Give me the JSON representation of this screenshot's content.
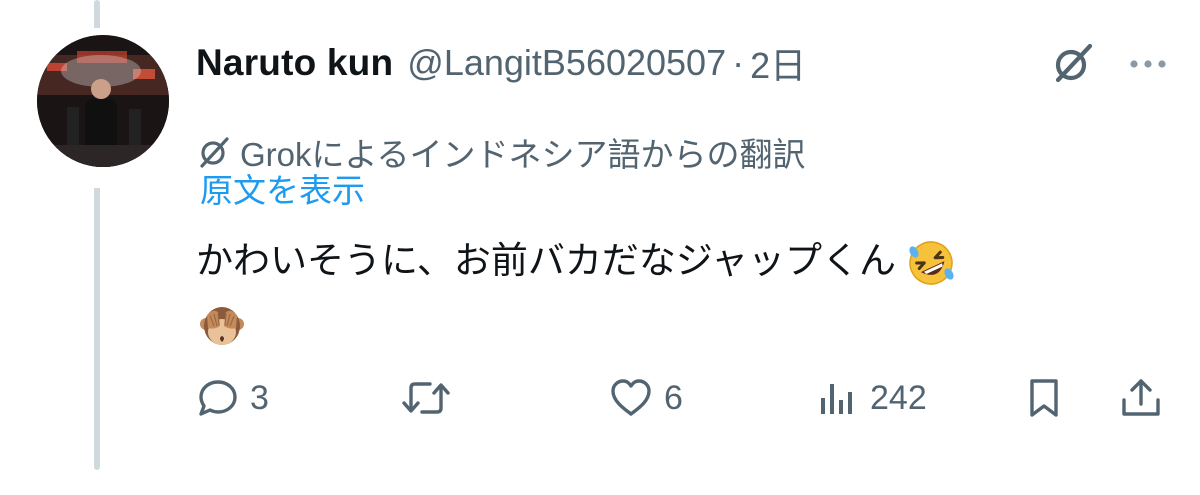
{
  "tweet": {
    "display_name": "Naruto kun",
    "handle": "@LangitB56020507",
    "separator": "·",
    "time": "2日",
    "translation_label": "Grokによるインドネシア語からの翻訳",
    "show_original": "原文を表示",
    "text": "かわいそうに、お前バカだなジャップくん",
    "emojis": [
      "rolling-on-floor-laughing-emoji",
      "see-no-evil-monkey-emoji"
    ]
  },
  "actions": {
    "reply_count": "3",
    "retweet_count": "",
    "like_count": "6",
    "views_count": "242"
  },
  "icons": {
    "grok": "grok-icon",
    "more": "more-icon",
    "reply": "reply-icon",
    "retweet": "retweet-icon",
    "like": "heart-icon",
    "views": "views-icon",
    "bookmark": "bookmark-icon",
    "share": "share-icon"
  },
  "colors": {
    "text": "#0f1419",
    "secondary": "#536471",
    "link": "#1d9bf0",
    "thread_line": "#cfd9de"
  }
}
